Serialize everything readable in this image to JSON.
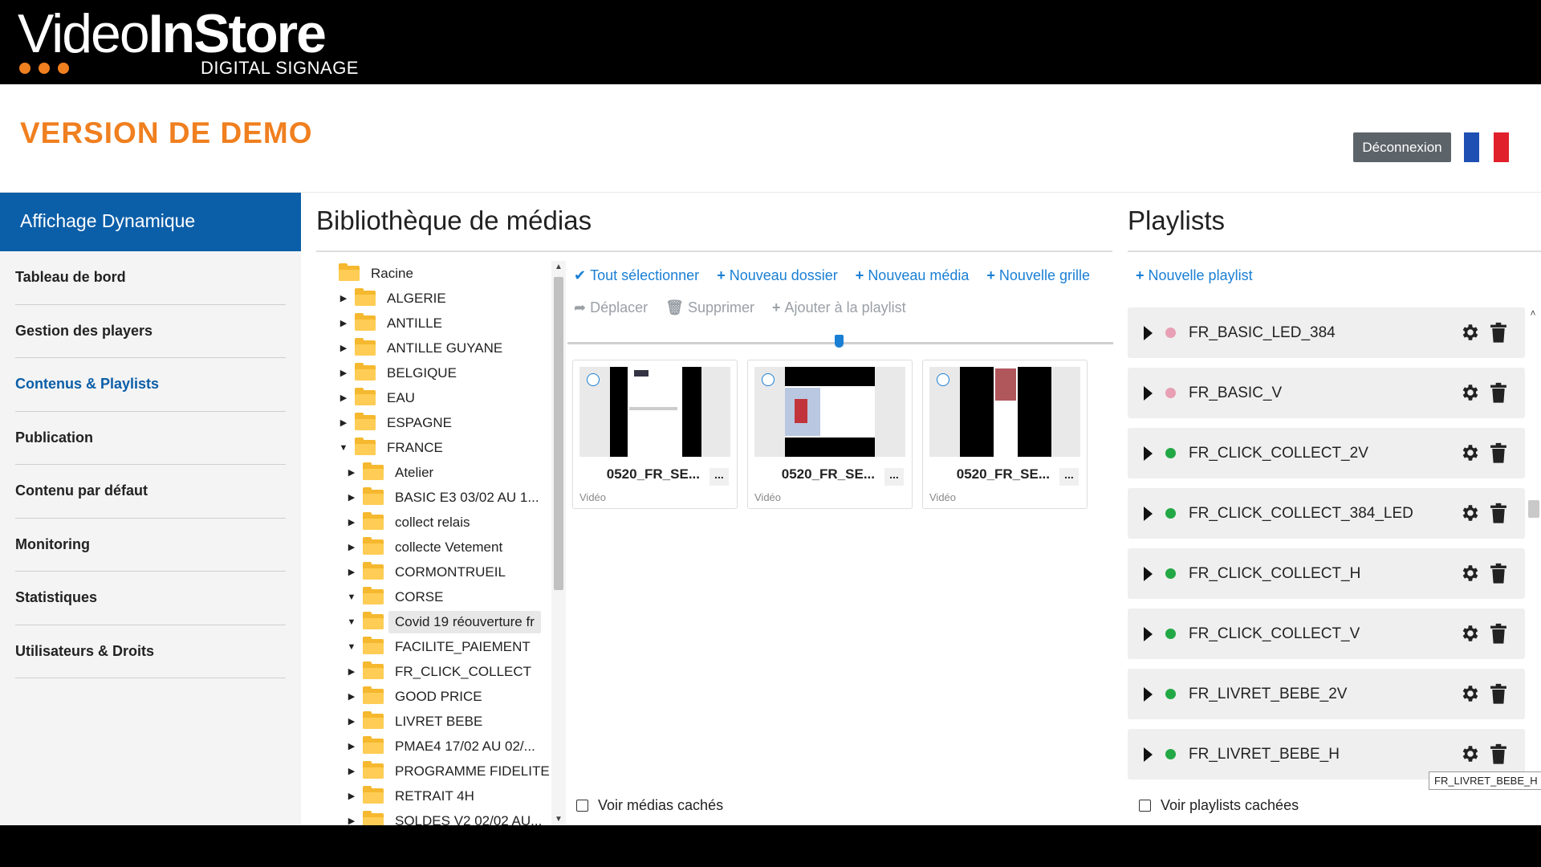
{
  "brand": {
    "logo_thin": "Video",
    "logo_bold": "InStore",
    "logo_sub": "DIGITAL SIGNAGE",
    "accent": "#f07f1f"
  },
  "header": {
    "demo_title": "VERSION DE DEMO",
    "logout_label": "Déconnexion",
    "flag_colors": [
      "#1f4fb3",
      "#ffffff",
      "#e0202a"
    ]
  },
  "sidebar": {
    "title": "Affichage Dynamique",
    "items": [
      {
        "label": "Tableau de bord"
      },
      {
        "label": "Gestion des players"
      },
      {
        "label": "Contenus & Playlists",
        "active": true
      },
      {
        "label": "Publication"
      },
      {
        "label": "Contenu par défaut"
      },
      {
        "label": "Monitoring"
      },
      {
        "label": "Statistiques"
      },
      {
        "label": "Utilisateurs & Droits"
      }
    ]
  },
  "media": {
    "title": "Bibliothèque de médias",
    "toolbar_primary": [
      {
        "icon": "check-icon",
        "label": "Tout sélectionner"
      },
      {
        "icon": "plus-icon",
        "label": "Nouveau dossier"
      },
      {
        "icon": "plus-icon",
        "label": "Nouveau média"
      },
      {
        "icon": "plus-icon",
        "label": "Nouvelle grille"
      }
    ],
    "toolbar_secondary": [
      {
        "icon": "share-icon",
        "label": "Déplacer"
      },
      {
        "icon": "trash-icon",
        "label": "Supprimer"
      },
      {
        "icon": "plus-icon",
        "label": "Ajouter à la playlist"
      }
    ],
    "tree": [
      {
        "label": "Racine",
        "level": 0,
        "arrow": ""
      },
      {
        "label": "ALGERIE",
        "level": 1,
        "arrow": "▶"
      },
      {
        "label": "ANTILLE",
        "level": 1,
        "arrow": "▶"
      },
      {
        "label": "ANTILLE GUYANE",
        "level": 1,
        "arrow": "▶"
      },
      {
        "label": "BELGIQUE",
        "level": 1,
        "arrow": "▶"
      },
      {
        "label": "EAU",
        "level": 1,
        "arrow": "▶"
      },
      {
        "label": "ESPAGNE",
        "level": 1,
        "arrow": "▶"
      },
      {
        "label": "FRANCE",
        "level": 1,
        "arrow": "▼"
      },
      {
        "label": "Atelier",
        "level": 2,
        "arrow": "▶"
      },
      {
        "label": "BASIC E3 03/02 AU 1...",
        "level": 2,
        "arrow": "▶"
      },
      {
        "label": "collect relais",
        "level": 2,
        "arrow": "▶"
      },
      {
        "label": "collecte Vetement",
        "level": 2,
        "arrow": "▶"
      },
      {
        "label": "CORMONTRUEIL",
        "level": 2,
        "arrow": "▶"
      },
      {
        "label": "CORSE",
        "level": 2,
        "arrow": "▼"
      },
      {
        "label": "Covid 19 réouverture fr",
        "level": 2,
        "arrow": "▼",
        "highlight": true
      },
      {
        "label": "FACILITE_PAIEMENT",
        "level": 2,
        "arrow": "▼"
      },
      {
        "label": "FR_CLICK_COLLECT",
        "level": 2,
        "arrow": "▶"
      },
      {
        "label": "GOOD PRICE",
        "level": 2,
        "arrow": "▶"
      },
      {
        "label": "LIVRET BEBE",
        "level": 2,
        "arrow": "▶"
      },
      {
        "label": "PMAE4 17/02 AU 02/...",
        "level": 2,
        "arrow": "▶"
      },
      {
        "label": "PROGRAMME FIDELITE",
        "level": 2,
        "arrow": "▶"
      },
      {
        "label": "RETRAIT 4H",
        "level": 2,
        "arrow": "▶"
      },
      {
        "label": "SOLDES V2 02/02 AU...",
        "level": 2,
        "arrow": "▶"
      }
    ],
    "thumbnails": [
      {
        "name": "0520_FR_SE...",
        "type": "Vidéo",
        "more": "..."
      },
      {
        "name": "0520_FR_SE...",
        "type": "Vidéo",
        "more": "..."
      },
      {
        "name": "0520_FR_SE...",
        "type": "Vidéo",
        "more": "..."
      }
    ],
    "show_hidden_label": "Voir médias cachés"
  },
  "playlists": {
    "title": "Playlists",
    "new_label": "Nouvelle playlist",
    "items": [
      {
        "name": "FR_BASIC_LED_384",
        "status_color": "#e8a0b4"
      },
      {
        "name": "FR_BASIC_V",
        "status_color": "#e8a0b4"
      },
      {
        "name": "FR_CLICK_COLLECT_2V",
        "status_color": "#22a845"
      },
      {
        "name": "FR_CLICK_COLLECT_384_LED",
        "status_color": "#22a845"
      },
      {
        "name": "FR_CLICK_COLLECT_H",
        "status_color": "#22a845"
      },
      {
        "name": "FR_CLICK_COLLECT_V",
        "status_color": "#22a845"
      },
      {
        "name": "FR_LIVRET_BEBE_2V",
        "status_color": "#22a845"
      },
      {
        "name": "FR_LIVRET_BEBE_H",
        "status_color": "#22a845"
      }
    ],
    "tooltip": "FR_LIVRET_BEBE_H",
    "show_hidden_label": "Voir playlists cachées"
  }
}
